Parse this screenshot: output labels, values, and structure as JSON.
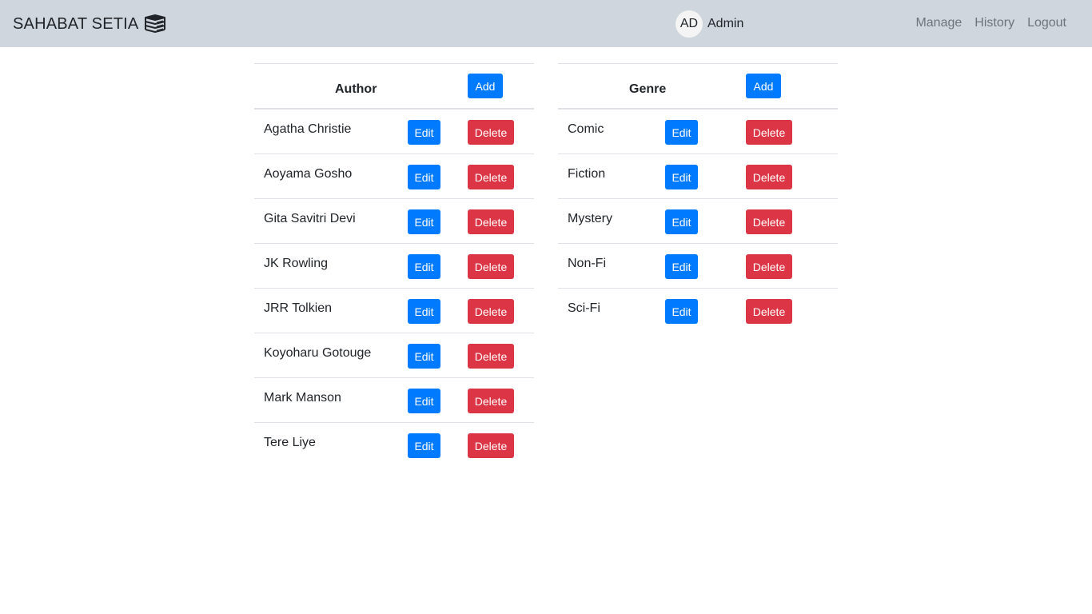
{
  "navbar": {
    "brand": "SAHABAT SETIA",
    "brand_icon": "books-stack-icon",
    "user_initials": "AD",
    "user_name": "Admin",
    "links": [
      "Manage",
      "History",
      "Logout"
    ]
  },
  "author_table": {
    "header": "Author",
    "add_label": "Add",
    "edit_label": "Edit",
    "delete_label": "Delete",
    "rows": [
      "Agatha Christie",
      "Aoyama Gosho",
      "Gita Savitri Devi",
      "JK Rowling",
      "JRR Tolkien",
      "Koyoharu Gotouge",
      "Mark Manson",
      "Tere Liye"
    ]
  },
  "genre_table": {
    "header": "Genre",
    "add_label": "Add",
    "edit_label": "Edit",
    "delete_label": "Delete",
    "rows": [
      "Comic",
      "Fiction",
      "Mystery",
      "Non-Fi",
      "Sci-Fi"
    ]
  },
  "colors": {
    "primary": "#007bff",
    "danger": "#dc3545",
    "navbar": "#cfd6dd"
  }
}
